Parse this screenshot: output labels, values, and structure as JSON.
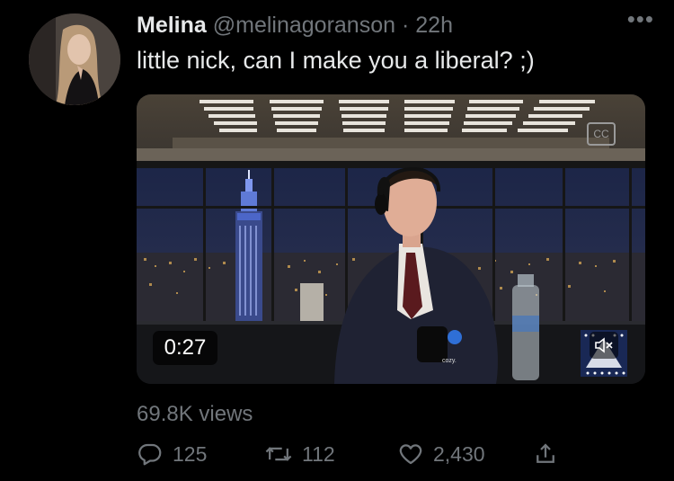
{
  "tweet": {
    "display_name": "Melina",
    "handle": "@melinagoranson",
    "separator": "·",
    "time_ago": "22h",
    "more_icon": "more-horizontal-icon",
    "text": "little nick, can I make you a liberal? ;)"
  },
  "video": {
    "duration": "0:27",
    "cc_label": "CC",
    "cc_icon": "closed-captions-off-icon",
    "mute_icon": "speaker-muted-icon",
    "mic_brand": "cozy."
  },
  "stats": {
    "views": "69.8K views"
  },
  "actions": {
    "reply": {
      "icon": "reply-icon",
      "count": "125"
    },
    "retweet": {
      "icon": "retweet-icon",
      "count": "112"
    },
    "like": {
      "icon": "heart-icon",
      "count": "2,430"
    },
    "share": {
      "icon": "share-icon"
    }
  },
  "colors": {
    "background": "#000000",
    "primary_text": "#e7e9ea",
    "secondary_text": "#71767b"
  }
}
